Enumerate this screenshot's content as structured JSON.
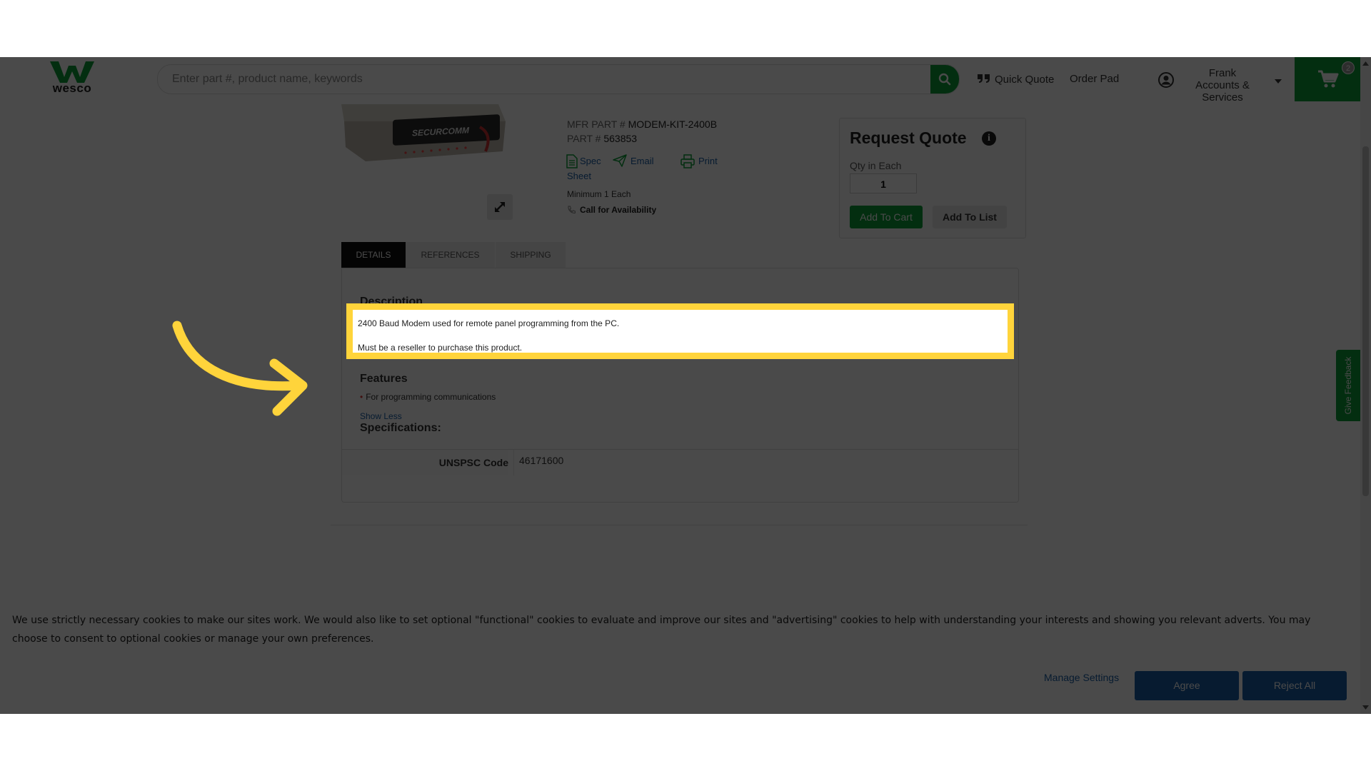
{
  "header": {
    "logo_text": "wesco",
    "search_placeholder": "Enter part #, product name, keywords",
    "quick_quote": "Quick Quote",
    "order_pad": "Order Pad",
    "account_name": "Frank",
    "account_sub": "Accounts & Services",
    "cart_count": "2"
  },
  "product": {
    "image_label": "SECURCOMM",
    "mfr_part_label": "MFR PART #",
    "mfr_part": "MODEM-KIT-2400B",
    "part_label": "PART #",
    "part": "563853",
    "spec_sheet_1": "Spec",
    "spec_sheet_2": "Sheet",
    "email": "Email",
    "print": "Print",
    "minimum": "Minimum 1 Each",
    "availability": "Call for Availability"
  },
  "request_quote": {
    "title": "Request Quote",
    "info": "i",
    "qty_label": "Qty in Each",
    "qty_value": "1",
    "add_to_cart": "Add To Cart",
    "add_to_list": "Add To List"
  },
  "tabs": [
    "DETAILS",
    "REFERENCES",
    "SHIPPING"
  ],
  "details": {
    "description_title": "Description",
    "description_1": "2400 Baud Modem used for remote panel programming from the PC.",
    "description_2": "Must be a reseller to purchase this product.",
    "features_title": "Features",
    "feature_1": "For programming communications",
    "show_less": "Show Less",
    "specs_title": "Specifications:",
    "spec_label": "UNSPSC Code",
    "spec_value": "46171600"
  },
  "feedback": "Give Feedback",
  "cookie": {
    "text": "We use strictly necessary cookies to make our sites work. We would also like to set optional \"functional\" cookies to evaluate and improve our sites and \"advertising\" cookies to help with understanding your interests and showing you relevant adverts. You may choose to consent to optional cookies or manage your own preferences.",
    "manage": "Manage Settings",
    "agree": "Agree",
    "reject": "Reject All"
  },
  "colors": {
    "brand_green": "#0b9e3a",
    "highlight_yellow": "#ffd43b",
    "link_blue": "#1a5fa6"
  }
}
